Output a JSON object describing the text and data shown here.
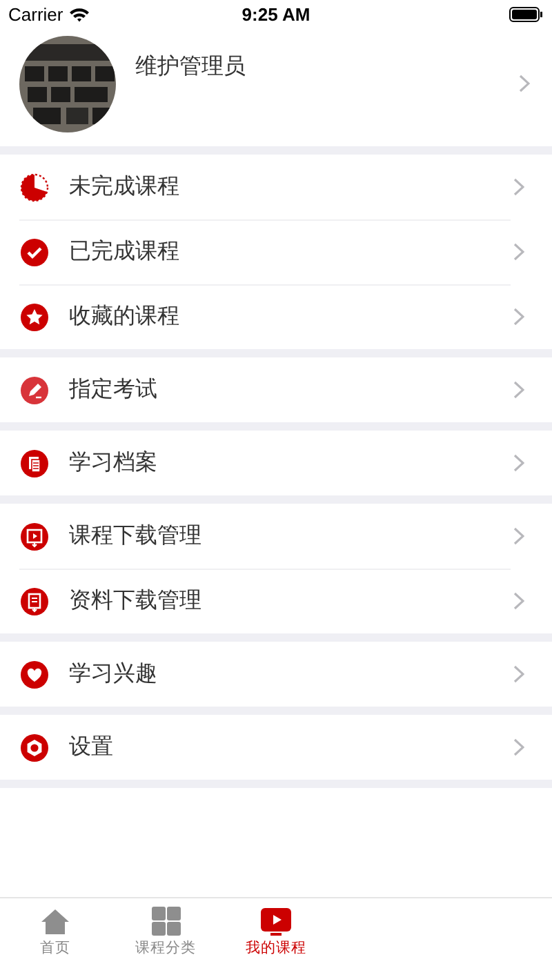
{
  "status_bar": {
    "carrier": "Carrier",
    "time": "9:25 AM"
  },
  "profile": {
    "name": "维护管理员"
  },
  "groups": [
    {
      "items": [
        {
          "kind": "pie",
          "label": "未完成课程"
        },
        {
          "kind": "check",
          "label": "已完成课程"
        },
        {
          "kind": "star",
          "label": "收藏的课程"
        }
      ]
    },
    {
      "items": [
        {
          "kind": "pencil",
          "label": "指定考试"
        }
      ]
    },
    {
      "items": [
        {
          "kind": "document",
          "label": "学习档案"
        }
      ]
    },
    {
      "items": [
        {
          "kind": "video-download",
          "label": "课程下载管理"
        },
        {
          "kind": "file-download",
          "label": "资料下载管理"
        }
      ]
    },
    {
      "items": [
        {
          "kind": "heart",
          "label": "学习兴趣"
        }
      ]
    },
    {
      "items": [
        {
          "kind": "gear",
          "label": "设置"
        }
      ]
    }
  ],
  "tab_bar": [
    {
      "kind": "home",
      "label": "首页",
      "selected": false
    },
    {
      "kind": "grid",
      "label": "课程分类",
      "selected": false
    },
    {
      "kind": "play",
      "label": "我的课程",
      "selected": true
    }
  ]
}
